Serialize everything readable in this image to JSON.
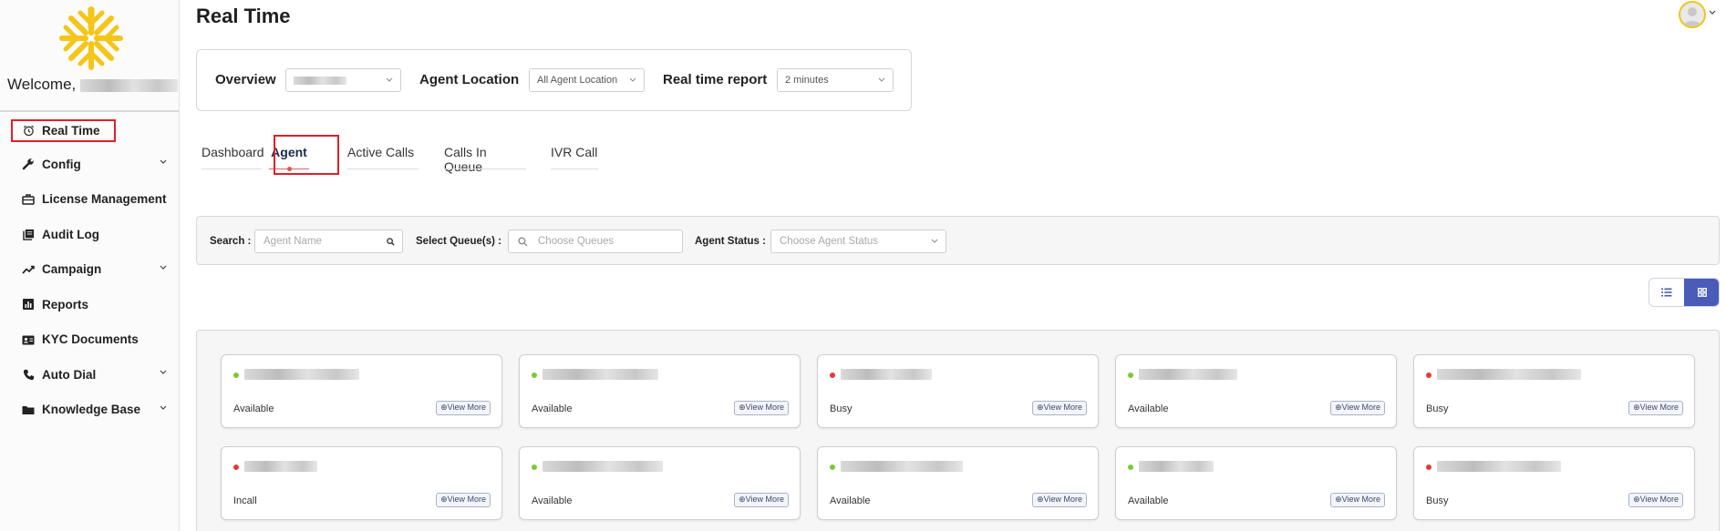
{
  "sidebar": {
    "welcome": "Welcome,",
    "items": [
      {
        "label": "Real Time",
        "icon": "alarm-clock-icon",
        "has_chevron": false
      },
      {
        "label": "Config",
        "icon": "wrench-icon",
        "has_chevron": true
      },
      {
        "label": "License Management",
        "icon": "briefcase-icon",
        "has_chevron": false
      },
      {
        "label": "Audit Log",
        "icon": "book-icon",
        "has_chevron": false
      },
      {
        "label": "Campaign",
        "icon": "trend-line-icon",
        "has_chevron": true
      },
      {
        "label": "Reports",
        "icon": "bar-chart-icon",
        "has_chevron": false
      },
      {
        "label": "KYC Documents",
        "icon": "id-card-icon",
        "has_chevron": false
      },
      {
        "label": "Auto Dial",
        "icon": "phone-icon",
        "has_chevron": true
      },
      {
        "label": "Knowledge Base",
        "icon": "folder-icon",
        "has_chevron": true
      }
    ]
  },
  "header": {
    "title": "Real Time"
  },
  "overview": {
    "overview_label": "Overview",
    "agent_location_label": "Agent Location",
    "agent_location_value": "All Agent Location",
    "report_label": "Real time report",
    "report_value": "2 minutes"
  },
  "tabs": [
    {
      "label": "Dashboard",
      "active": false
    },
    {
      "label": "Agent",
      "active": true
    },
    {
      "label": "Active Calls",
      "active": false
    },
    {
      "label": "Calls In Queue",
      "active": false
    },
    {
      "label": "IVR Call",
      "active": false
    }
  ],
  "filters": {
    "search_label": "Search :",
    "search_placeholder": "Agent Name",
    "queues_label": "Select Queue(s) :",
    "queues_placeholder": "Choose Queues",
    "status_label": "Agent Status :",
    "status_placeholder": "Choose Agent Status"
  },
  "colors": {
    "accent": "#4a5cb8",
    "available": "#7cc934",
    "busy": "#e53935",
    "highlight": "#e0202a",
    "logo": "#f5c518"
  },
  "view_more_label": "View More",
  "agents": [
    {
      "status": "Available",
      "state": "available"
    },
    {
      "status": "Available",
      "state": "available"
    },
    {
      "status": "Busy",
      "state": "busy"
    },
    {
      "status": "Available",
      "state": "available"
    },
    {
      "status": "Busy",
      "state": "busy"
    },
    {
      "status": "Incall",
      "state": "busy"
    },
    {
      "status": "Available",
      "state": "available"
    },
    {
      "status": "Available",
      "state": "available"
    },
    {
      "status": "Available",
      "state": "available"
    },
    {
      "status": "Busy",
      "state": "busy"
    }
  ]
}
